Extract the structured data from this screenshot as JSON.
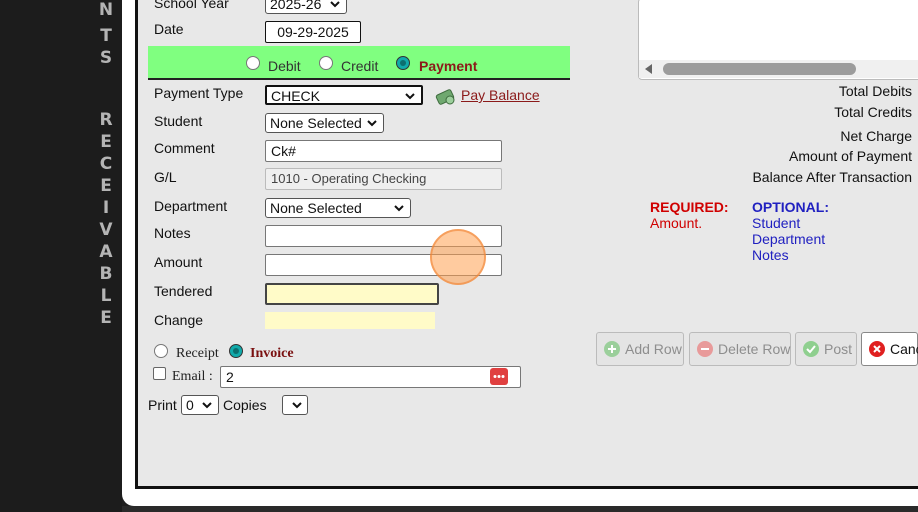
{
  "side_title_chars": [
    "N",
    "T",
    "S",
    "R",
    "E",
    "C",
    "E",
    "I",
    "V",
    "A",
    "B",
    "L",
    "E"
  ],
  "form": {
    "school_year_label": "School Year",
    "school_year_value": "2025-26",
    "date_label": "Date",
    "date_value": "09-29-2025",
    "types": [
      {
        "label": "Debit",
        "selected": false
      },
      {
        "label": "Credit",
        "selected": false
      },
      {
        "label": "Payment",
        "selected": true
      }
    ],
    "payment_type_label": "Payment Type",
    "payment_type_value": "CHECK",
    "pay_balance_link": "Pay Balance",
    "student_label": "Student",
    "student_value": "None Selected",
    "comment_label": "Comment",
    "comment_value": "Ck#",
    "gl_label": "G/L",
    "gl_value": "1010 - Operating Checking",
    "department_label": "Department",
    "department_value": "None Selected",
    "notes_label": "Notes",
    "notes_value": "",
    "amount_label": "Amount",
    "amount_value": "",
    "tendered_label": "Tendered",
    "tendered_value": "",
    "change_label": "Change",
    "change_value": "",
    "receipt_label": "Receipt",
    "invoice_label": "Invoice",
    "email_label": "Email :",
    "email_value": "2",
    "print_label": "Print",
    "print_value": "0",
    "copies_label": "Copies",
    "copies_value": ""
  },
  "totals": {
    "total_debits": "Total Debits",
    "total_credits": "Total Credits",
    "net_charge": "Net Charge",
    "amount_of_payment": "Amount of Payment",
    "balance_after": "Balance After Transaction"
  },
  "requirements": {
    "required_title": "REQUIRED:",
    "required_items": [
      "Amount."
    ],
    "optional_title": "OPTIONAL:",
    "optional_items": [
      "Student",
      "Department",
      "Notes"
    ]
  },
  "buttons": {
    "add_row": "Add Row",
    "delete_row": "Delete Row",
    "post": "Post",
    "cancel": "Canc"
  },
  "colors": {
    "type_bar": "#80ff80",
    "required": "#d00000",
    "optional": "#2020c0",
    "link": "#8b1a1a",
    "invoice": "#7a1010",
    "tendered_bg": "#fffbc8"
  }
}
